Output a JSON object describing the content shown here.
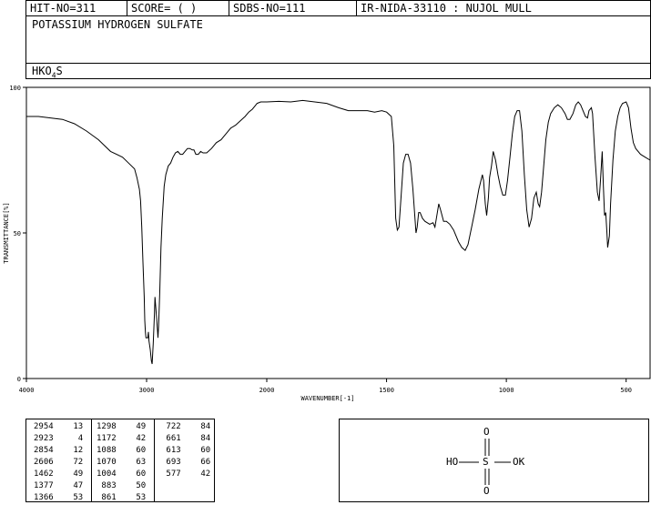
{
  "header": {
    "hit_no": "HIT-NO=311",
    "score": "SCORE=  (   )",
    "sdbs_no": "SDBS-NO=111",
    "ir_info": "IR-NIDA-33110 : NUJOL MULL"
  },
  "compound_name": "POTASSIUM HYDROGEN SULFATE",
  "formula": {
    "prefix": "HKO",
    "subscript": "4",
    "suffix": "S"
  },
  "chart_data": {
    "type": "line",
    "xlabel": "WAVENUMBER[-1]",
    "ylabel": "TRANSMITTANCE[%]",
    "xlim": [
      4000,
      400
    ],
    "ylim": [
      0,
      100
    ],
    "x_ticks": [
      "4000",
      "3000",
      "2000",
      "1500",
      "1000",
      "500"
    ],
    "y_ticks": [
      "100",
      "50",
      "0"
    ],
    "grid": false,
    "series": [
      {
        "points": [
          [
            4000,
            90
          ],
          [
            3900,
            90
          ],
          [
            3800,
            89.5
          ],
          [
            3700,
            89
          ],
          [
            3600,
            87.5
          ],
          [
            3500,
            85
          ],
          [
            3400,
            82
          ],
          [
            3300,
            78
          ],
          [
            3200,
            76
          ],
          [
            3150,
            74
          ],
          [
            3100,
            72
          ],
          [
            3080,
            69
          ],
          [
            3060,
            65
          ],
          [
            3050,
            61
          ],
          [
            3040,
            52
          ],
          [
            3030,
            40
          ],
          [
            3020,
            28
          ],
          [
            3015,
            20
          ],
          [
            3010,
            16
          ],
          [
            3005,
            14
          ],
          [
            2990,
            14
          ],
          [
            2985,
            16
          ],
          [
            2980,
            13
          ],
          [
            2970,
            10
          ],
          [
            2960,
            6
          ],
          [
            2954,
            5
          ],
          [
            2945,
            12
          ],
          [
            2935,
            22
          ],
          [
            2930,
            28
          ],
          [
            2923,
            24
          ],
          [
            2915,
            20
          ],
          [
            2905,
            14
          ],
          [
            2900,
            18
          ],
          [
            2890,
            30
          ],
          [
            2880,
            45
          ],
          [
            2870,
            55
          ],
          [
            2854,
            66
          ],
          [
            2840,
            70
          ],
          [
            2820,
            73
          ],
          [
            2800,
            74
          ],
          [
            2780,
            76
          ],
          [
            2760,
            77.5
          ],
          [
            2740,
            78
          ],
          [
            2720,
            77
          ],
          [
            2700,
            77
          ],
          [
            2680,
            78
          ],
          [
            2660,
            79
          ],
          [
            2640,
            79
          ],
          [
            2620,
            78.5
          ],
          [
            2606,
            78.5
          ],
          [
            2590,
            77
          ],
          [
            2570,
            77
          ],
          [
            2550,
            78
          ],
          [
            2530,
            77.5
          ],
          [
            2500,
            77.5
          ],
          [
            2460,
            79
          ],
          [
            2420,
            81
          ],
          [
            2380,
            82
          ],
          [
            2340,
            84
          ],
          [
            2300,
            86
          ],
          [
            2260,
            87
          ],
          [
            2220,
            88.5
          ],
          [
            2180,
            90
          ],
          [
            2150,
            91.5
          ],
          [
            2120,
            92.5
          ],
          [
            2100,
            93.5
          ],
          [
            2080,
            94.5
          ],
          [
            2050,
            95
          ],
          [
            2000,
            95
          ],
          [
            1950,
            95.2
          ],
          [
            1900,
            95
          ],
          [
            1850,
            95.5
          ],
          [
            1800,
            95
          ],
          [
            1750,
            94.5
          ],
          [
            1700,
            93
          ],
          [
            1660,
            92
          ],
          [
            1620,
            92
          ],
          [
            1580,
            92
          ],
          [
            1550,
            91.5
          ],
          [
            1520,
            92
          ],
          [
            1500,
            91.5
          ],
          [
            1480,
            90
          ],
          [
            1470,
            80
          ],
          [
            1462,
            55
          ],
          [
            1455,
            51
          ],
          [
            1448,
            52
          ],
          [
            1440,
            62
          ],
          [
            1430,
            74
          ],
          [
            1420,
            77
          ],
          [
            1410,
            77
          ],
          [
            1400,
            74
          ],
          [
            1390,
            65
          ],
          [
            1377,
            50
          ],
          [
            1372,
            52
          ],
          [
            1366,
            57
          ],
          [
            1360,
            57
          ],
          [
            1350,
            55
          ],
          [
            1340,
            54
          ],
          [
            1320,
            53
          ],
          [
            1306,
            53.5
          ],
          [
            1298,
            52
          ],
          [
            1290,
            56
          ],
          [
            1282,
            60
          ],
          [
            1275,
            58
          ],
          [
            1262,
            54
          ],
          [
            1250,
            54
          ],
          [
            1236,
            53
          ],
          [
            1220,
            51
          ],
          [
            1200,
            47
          ],
          [
            1186,
            45
          ],
          [
            1172,
            44
          ],
          [
            1160,
            46
          ],
          [
            1145,
            52
          ],
          [
            1130,
            58
          ],
          [
            1115,
            65
          ],
          [
            1100,
            70
          ],
          [
            1095,
            68
          ],
          [
            1088,
            60
          ],
          [
            1082,
            56
          ],
          [
            1075,
            62
          ],
          [
            1070,
            69
          ],
          [
            1062,
            73
          ],
          [
            1055,
            78
          ],
          [
            1045,
            75
          ],
          [
            1035,
            70
          ],
          [
            1025,
            66
          ],
          [
            1015,
            63
          ],
          [
            1004,
            63
          ],
          [
            995,
            68
          ],
          [
            985,
            76
          ],
          [
            975,
            84
          ],
          [
            965,
            90
          ],
          [
            955,
            92
          ],
          [
            945,
            92
          ],
          [
            935,
            85
          ],
          [
            925,
            70
          ],
          [
            915,
            58
          ],
          [
            905,
            52
          ],
          [
            895,
            55
          ],
          [
            885,
            62
          ],
          [
            875,
            64
          ],
          [
            867,
            60
          ],
          [
            861,
            59
          ],
          [
            853,
            64
          ],
          [
            845,
            72
          ],
          [
            835,
            82
          ],
          [
            825,
            88
          ],
          [
            815,
            91
          ],
          [
            800,
            93
          ],
          [
            785,
            94
          ],
          [
            770,
            93
          ],
          [
            755,
            91
          ],
          [
            745,
            89
          ],
          [
            735,
            89
          ],
          [
            722,
            91
          ],
          [
            710,
            94
          ],
          [
            700,
            95
          ],
          [
            690,
            94
          ],
          [
            680,
            92
          ],
          [
            670,
            90
          ],
          [
            661,
            89.5
          ],
          [
            655,
            92
          ],
          [
            645,
            93
          ],
          [
            640,
            91
          ],
          [
            630,
            76
          ],
          [
            620,
            64
          ],
          [
            613,
            61
          ],
          [
            607,
            68
          ],
          [
            600,
            78
          ],
          [
            595,
            66
          ],
          [
            590,
            56
          ],
          [
            585,
            57
          ],
          [
            580,
            50
          ],
          [
            577,
            45
          ],
          [
            570,
            49
          ],
          [
            565,
            60
          ],
          [
            555,
            75
          ],
          [
            545,
            85
          ],
          [
            535,
            90
          ],
          [
            525,
            93
          ],
          [
            515,
            94.5
          ],
          [
            500,
            95
          ],
          [
            490,
            93
          ],
          [
            480,
            86
          ],
          [
            470,
            81
          ],
          [
            460,
            79
          ],
          [
            440,
            77
          ],
          [
            420,
            76
          ],
          [
            400,
            75
          ]
        ]
      }
    ]
  },
  "peak_table": {
    "columns": [
      [
        [
          "2954",
          "13"
        ],
        [
          "2923",
          "4"
        ],
        [
          "2854",
          "12"
        ],
        [
          "2606",
          "72"
        ],
        [
          "1462",
          "49"
        ],
        [
          "1377",
          "47"
        ],
        [
          "1366",
          "53"
        ]
      ],
      [
        [
          "1298",
          "49"
        ],
        [
          "1172",
          "42"
        ],
        [
          "1088",
          "60"
        ],
        [
          "1070",
          "63"
        ],
        [
          "1004",
          "60"
        ],
        [
          "883",
          "50"
        ],
        [
          "861",
          "53"
        ]
      ],
      [
        [
          "722",
          "84"
        ],
        [
          "661",
          "84"
        ],
        [
          "613",
          "60"
        ],
        [
          "693",
          "66"
        ],
        [
          "577",
          "42"
        ]
      ]
    ]
  },
  "structure": {
    "atoms": {
      "ho": "HO",
      "s": "S",
      "ok": "OK",
      "o_top": "O",
      "o_bottom": "O"
    }
  }
}
